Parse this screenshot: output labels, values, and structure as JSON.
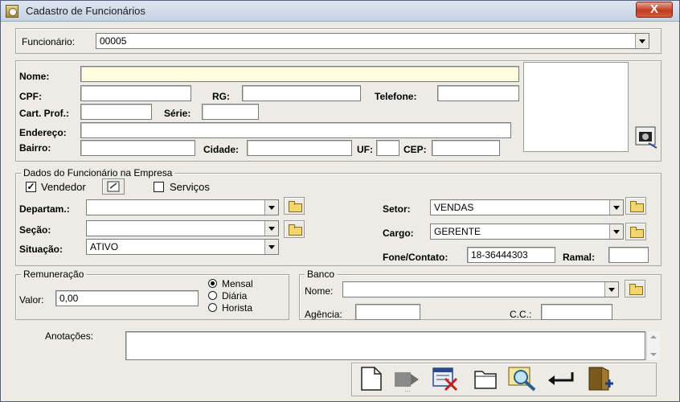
{
  "window": {
    "title": "Cadastro de Funcionários",
    "close_label": "X"
  },
  "header": {
    "funcionario_label": "Funcionário:",
    "funcionario_value": "00005"
  },
  "personal": {
    "nome_label": "Nome:",
    "nome_value": "",
    "cpf_label": "CPF:",
    "cpf_value": "",
    "rg_label": "RG:",
    "rg_value": "",
    "telefone_label": "Telefone:",
    "telefone_value": "",
    "cart_label": "Cart. Prof.:",
    "cart_value": "",
    "serie_label": "Série:",
    "serie_value": "",
    "endereco_label": "Endereço:",
    "endereco_value": "",
    "bairro_label": "Bairro:",
    "bairro_value": "",
    "cidade_label": "Cidade:",
    "cidade_value": "",
    "uf_label": "UF:",
    "uf_value": "",
    "cep_label": "CEP:",
    "cep_value": ""
  },
  "empresa": {
    "legend": "Dados do Funcionário na Empresa",
    "vendedor_label": "Vendedor",
    "vendedor_checked": "✓",
    "servicos_label": "Serviços",
    "departam_label": "Departam.:",
    "departam_value": "",
    "secao_label": "Seção:",
    "secao_value": "",
    "situacao_label": "Situação:",
    "situacao_value": "ATIVO",
    "setor_label": "Setor:",
    "setor_value": "VENDAS",
    "cargo_label": "Cargo:",
    "cargo_value": "GERENTE",
    "fone_label": "Fone/Contato:",
    "fone_value": "18-36444303",
    "ramal_label": "Ramal:",
    "ramal_value": ""
  },
  "remuneracao": {
    "legend": "Remuneração",
    "valor_label": "Valor:",
    "valor_value": "0,00",
    "options": [
      "Mensal",
      "Diária",
      "Horista"
    ],
    "selected": "Mensal"
  },
  "banco": {
    "legend": "Banco",
    "nome_label": "Nome:",
    "nome_value": "",
    "agencia_label": "Agência:",
    "agencia_value": "",
    "cc_label": "C.C.:",
    "cc_value": ""
  },
  "anotacoes": {
    "label": "Anotações:",
    "value": ""
  },
  "toolbar": [
    "new-document-icon",
    "save-icon",
    "delete-icon",
    "open-icon",
    "search-icon",
    "confirm-icon",
    "exit-icon"
  ]
}
